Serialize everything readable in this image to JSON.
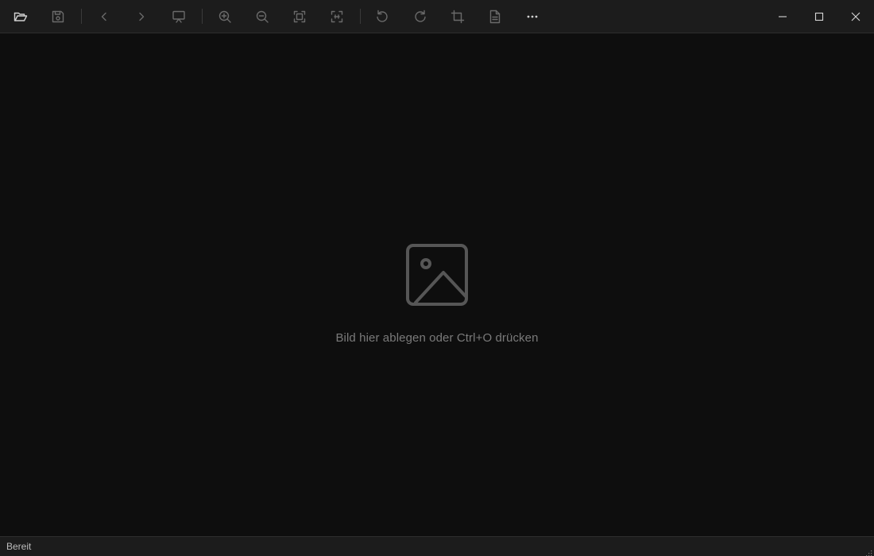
{
  "toolbar": {
    "buttons": [
      {
        "icon": "open-folder-icon",
        "state": "enabled"
      },
      {
        "icon": "save-icon",
        "state": "disabled"
      },
      {
        "icon": "chevron-left-icon",
        "state": "disabled"
      },
      {
        "icon": "chevron-right-icon",
        "state": "disabled"
      },
      {
        "icon": "slideshow-icon",
        "state": "disabled"
      },
      {
        "icon": "zoom-in-icon",
        "state": "disabled"
      },
      {
        "icon": "zoom-out-icon",
        "state": "disabled"
      },
      {
        "icon": "fit-to-window-icon",
        "state": "disabled"
      },
      {
        "icon": "actual-size-icon",
        "state": "disabled"
      },
      {
        "icon": "rotate-left-icon",
        "state": "disabled"
      },
      {
        "icon": "rotate-right-icon",
        "state": "disabled"
      },
      {
        "icon": "crop-icon",
        "state": "disabled"
      },
      {
        "icon": "image-info-icon",
        "state": "disabled"
      },
      {
        "icon": "more-icon",
        "state": "enabled"
      }
    ]
  },
  "window_controls": [
    "minimize-icon",
    "maximize-icon",
    "close-icon"
  ],
  "canvas": {
    "placeholder_icon": "image-placeholder-icon",
    "placeholder_text": "Bild hier ablegen oder Ctrl+O drücken"
  },
  "statusbar": {
    "status_text": "Bereit"
  },
  "colors": {
    "toolbar_bg": "#1c1c1c",
    "canvas_bg": "#0e0e0e",
    "icon_enabled": "#d0d0d0",
    "icon_disabled": "#6a6a6a",
    "placeholder": "#565656"
  }
}
